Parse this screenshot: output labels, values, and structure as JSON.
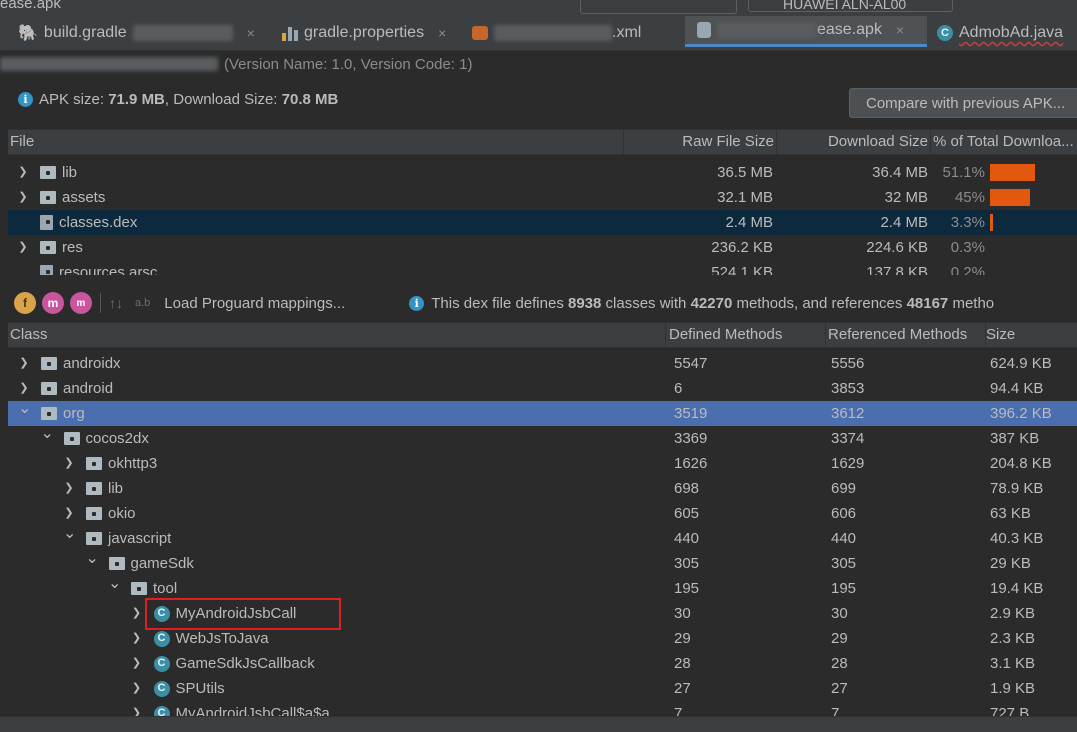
{
  "window": {
    "top_title": "ease.apk",
    "device": "HUAWEI ALN-AL00"
  },
  "tabs": [
    {
      "label": "build.gradle",
      "close": "×"
    },
    {
      "label": "gradle.properties",
      "close": "×"
    },
    {
      "label": ".xml",
      "close": ""
    },
    {
      "label": "ease.apk",
      "close": "×"
    },
    {
      "label": "AdmobAd.java",
      "close": ""
    }
  ],
  "version_line": "(Version Name: 1.0, Version Code: 1)",
  "apk_info": {
    "size_label": "APK size: ",
    "size_value": "71.9 MB",
    "download_label": ", Download Size: ",
    "download_value": "70.8 MB"
  },
  "compare_button": "Compare with previous APK...",
  "file_table": {
    "headers": [
      "File",
      "Raw File Size",
      "Download Size",
      "% of Total Downloa..."
    ],
    "rows": [
      {
        "name": "lib",
        "raw": "36.5 MB",
        "download": "36.4 MB",
        "pct": "51.1%",
        "fraction": 0.511,
        "expandable": true
      },
      {
        "name": "assets",
        "raw": "32.1 MB",
        "download": "32 MB",
        "pct": "45%",
        "fraction": 0.45,
        "expandable": true
      },
      {
        "name": "classes.dex",
        "raw": "2.4 MB",
        "download": "2.4 MB",
        "pct": "3.3%",
        "fraction": 0.033,
        "expandable": false
      },
      {
        "name": "res",
        "raw": "236.2 KB",
        "download": "224.6 KB",
        "pct": "0.3%",
        "fraction": 0.003,
        "expandable": true
      },
      {
        "name": "resources.arsc",
        "raw": "524.1 KB",
        "download": "137.8 KB",
        "pct": "0.2%",
        "fraction": 0.002,
        "expandable": false
      }
    ]
  },
  "dex_toolbar": {
    "load_mappings": "Load Proguard mappings...",
    "info_prefix": "This dex file defines ",
    "classes": "8938",
    "mid1": " classes with ",
    "methods": "42270",
    "mid2": " methods, and references ",
    "refs": "48167",
    "suffix": " metho"
  },
  "class_table": {
    "headers": [
      "Class",
      "Defined Methods",
      "Referenced Methods",
      "Size"
    ],
    "rows": [
      {
        "name": "androidx",
        "defined": "5547",
        "referenced": "5556",
        "size": "624.9 KB",
        "depth": 0,
        "kind": "package",
        "state": "collapsed"
      },
      {
        "name": "android",
        "defined": "6",
        "referenced": "3853",
        "size": "94.4 KB",
        "depth": 0,
        "kind": "package",
        "state": "collapsed"
      },
      {
        "name": "org",
        "defined": "3519",
        "referenced": "3612",
        "size": "396.2 KB",
        "depth": 0,
        "kind": "package",
        "state": "expanded"
      },
      {
        "name": "cocos2dx",
        "defined": "3369",
        "referenced": "3374",
        "size": "387 KB",
        "depth": 1,
        "kind": "package",
        "state": "expanded"
      },
      {
        "name": "okhttp3",
        "defined": "1626",
        "referenced": "1629",
        "size": "204.8 KB",
        "depth": 2,
        "kind": "package",
        "state": "collapsed"
      },
      {
        "name": "lib",
        "defined": "698",
        "referenced": "699",
        "size": "78.9 KB",
        "depth": 2,
        "kind": "package",
        "state": "collapsed"
      },
      {
        "name": "okio",
        "defined": "605",
        "referenced": "606",
        "size": "63 KB",
        "depth": 2,
        "kind": "package",
        "state": "collapsed"
      },
      {
        "name": "javascript",
        "defined": "440",
        "referenced": "440",
        "size": "40.3 KB",
        "depth": 2,
        "kind": "package",
        "state": "expanded"
      },
      {
        "name": "gameSdk",
        "defined": "305",
        "referenced": "305",
        "size": "29 KB",
        "depth": 3,
        "kind": "package",
        "state": "expanded"
      },
      {
        "name": "tool",
        "defined": "195",
        "referenced": "195",
        "size": "19.4 KB",
        "depth": 4,
        "kind": "package",
        "state": "expanded"
      },
      {
        "name": "MyAndroidJsbCall",
        "defined": "30",
        "referenced": "30",
        "size": "2.9 KB",
        "depth": 5,
        "kind": "class",
        "state": "collapsed"
      },
      {
        "name": "WebJsToJava",
        "defined": "29",
        "referenced": "29",
        "size": "2.3 KB",
        "depth": 5,
        "kind": "class",
        "state": "collapsed"
      },
      {
        "name": "GameSdkJsCallback",
        "defined": "28",
        "referenced": "28",
        "size": "3.1 KB",
        "depth": 5,
        "kind": "class",
        "state": "collapsed"
      },
      {
        "name": "SPUtils",
        "defined": "27",
        "referenced": "27",
        "size": "1.9 KB",
        "depth": 5,
        "kind": "class",
        "state": "collapsed"
      },
      {
        "name": "MyAndroidJsbCall$a$a",
        "defined": "7",
        "referenced": "7",
        "size": "727 B",
        "depth": 5,
        "kind": "class",
        "state": "collapsed"
      }
    ]
  },
  "colors": {
    "accent": "#4b6eaf",
    "bar": "#e3580f",
    "highlight": "#e02020",
    "class_icon": "#3a8fa6"
  }
}
